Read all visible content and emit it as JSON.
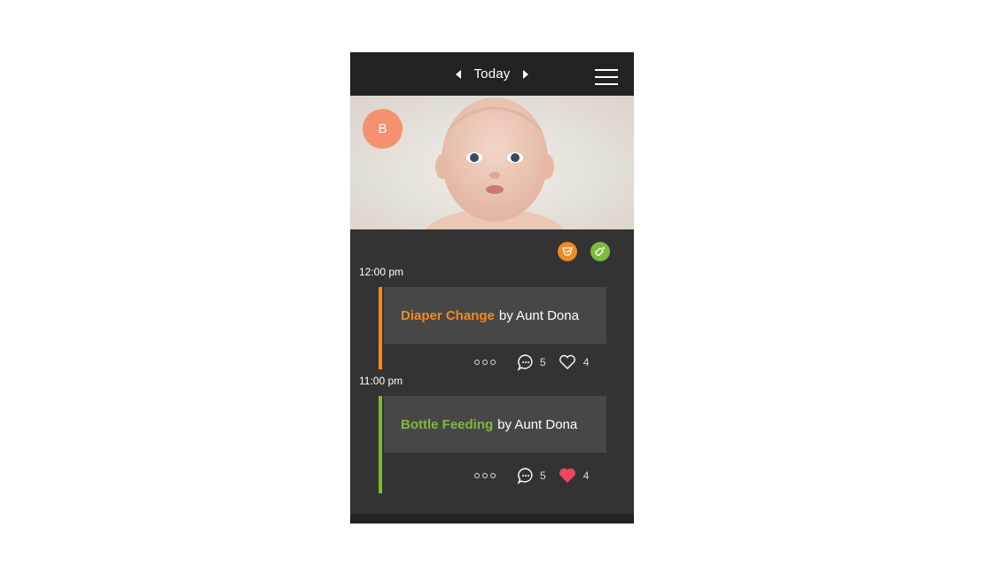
{
  "header": {
    "date_label": "Today"
  },
  "profile": {
    "initial": "B",
    "color": "#f4926f"
  },
  "filters": [
    {
      "name": "diaper-filter",
      "color": "#f08a24"
    },
    {
      "name": "bottle-filter",
      "color": "#7dbb3c"
    }
  ],
  "timeline": [
    {
      "time": "12:00 pm",
      "type": "Diaper Change",
      "by": "by Aunt Dona",
      "color": "#f08a24",
      "comments": "5",
      "likes": "4",
      "liked": false
    },
    {
      "time": "11:00 pm",
      "type": "Bottle Feeding",
      "by": "by Aunt Dona",
      "color": "#7dbb3c",
      "comments": "5",
      "likes": "4",
      "liked": true
    }
  ]
}
